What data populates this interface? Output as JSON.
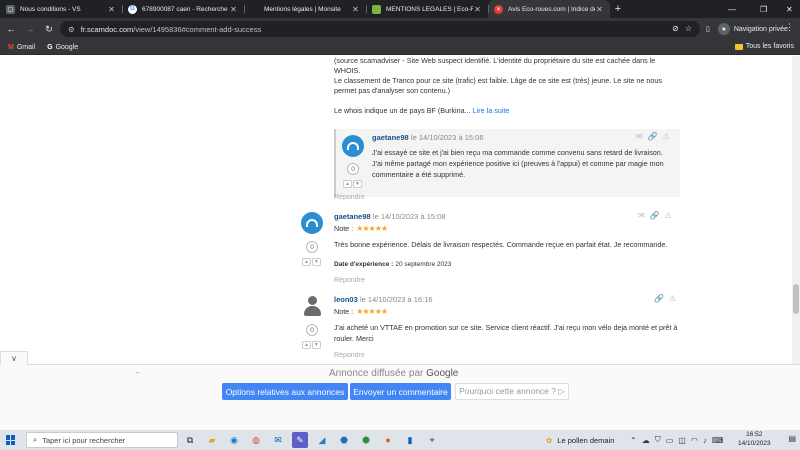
{
  "browser": {
    "tabs": [
      {
        "label": "Nous conditions - VS",
        "favicon_color": "#5f6368",
        "active": false
      },
      {
        "label": "678900087 caen - Recherche Go",
        "favicon_color": "#4285f4",
        "active": false
      },
      {
        "label": "Mentions légales | Monsite",
        "favicon_color": "#202124",
        "active": false
      },
      {
        "label": "MENTIONS LÉGALES | Eco-Roues",
        "favicon_color": "#7cb342",
        "active": false
      },
      {
        "label": "Avis Eco-roues.com | Indice de c",
        "favicon_color": "#e53935",
        "active": true
      }
    ],
    "url_host": "fr.scamdoc.com",
    "url_path": "/view/1495836#comment-add-success",
    "profile_label": "Navigation privée",
    "bookmarks": [
      {
        "label": "Gmail",
        "icon": "gmail-icon"
      },
      {
        "label": "Google",
        "icon": "google-icon"
      }
    ],
    "all_bookmarks_label": "Tous les favoris"
  },
  "page": {
    "top_text": {
      "p1_line1": "(source scamadviser - Site Web suspect identifié. L'identité du propriétaire du site est cachée dans le",
      "p1_line2": "WHOIS.",
      "p2_line1": "Le classement de Tranco pour ce site (trafic) est faible. Lâge de ce site est (très) jeune. Le site ne nous",
      "p2_line2": "permet pas d'analyser son contenu.)",
      "p3": "Le whois indique un de pays BF (Burkina...",
      "read_more": "Lire la suite"
    },
    "reply": {
      "author": "gaetane98",
      "date": "le 14/10/2023 à 15:06",
      "line1": "J'ai essayé ce site et j'ai bien reçu ma commande comme convenu sans retard de livraison.",
      "line2": "J'ai même partagé mon expérience positive ici (preuves à l'appui) et comme par magie mon",
      "line3": "commentaire a été supprimé.",
      "votes": "0"
    },
    "reply_link_label": "Répondre",
    "reviews": [
      {
        "author": "gaetane98",
        "date": "le 14/10/2023 à 15:08",
        "note_label": "Note :",
        "stars": "★★★★★",
        "text_line1": "Très bonne expérience. Délais de livraison respectés. Commande reçue en parfait état. Je recommande.",
        "experience_label": "Date d'expérience :",
        "experience_date": "20 septembre 2023",
        "votes": "0"
      },
      {
        "author": "leon03",
        "date": "le 14/10/2023 à 16:16",
        "note_label": "Note :",
        "stars": "★★★★★",
        "text_line1": "J'ai acheté un VTTAE en promotion sur ce site. Service client réactif. J'ai reçu mon vélo deja monté et prêt à",
        "text_line2": "rouler. Merci",
        "votes": "0"
      }
    ]
  },
  "ad": {
    "title_prefix": "Annonce diffusée par",
    "title_brand": "Google",
    "buttons": {
      "options": "Options relatives aux annonces",
      "comment": "Envoyer un commentaire",
      "why": "Pourquoi cette annonce ? ▷"
    }
  },
  "taskbar": {
    "search_placeholder": "Taper ici pour rechercher",
    "weather": "Le pollen demain",
    "time": "16:52",
    "date": "14/10/2023"
  }
}
